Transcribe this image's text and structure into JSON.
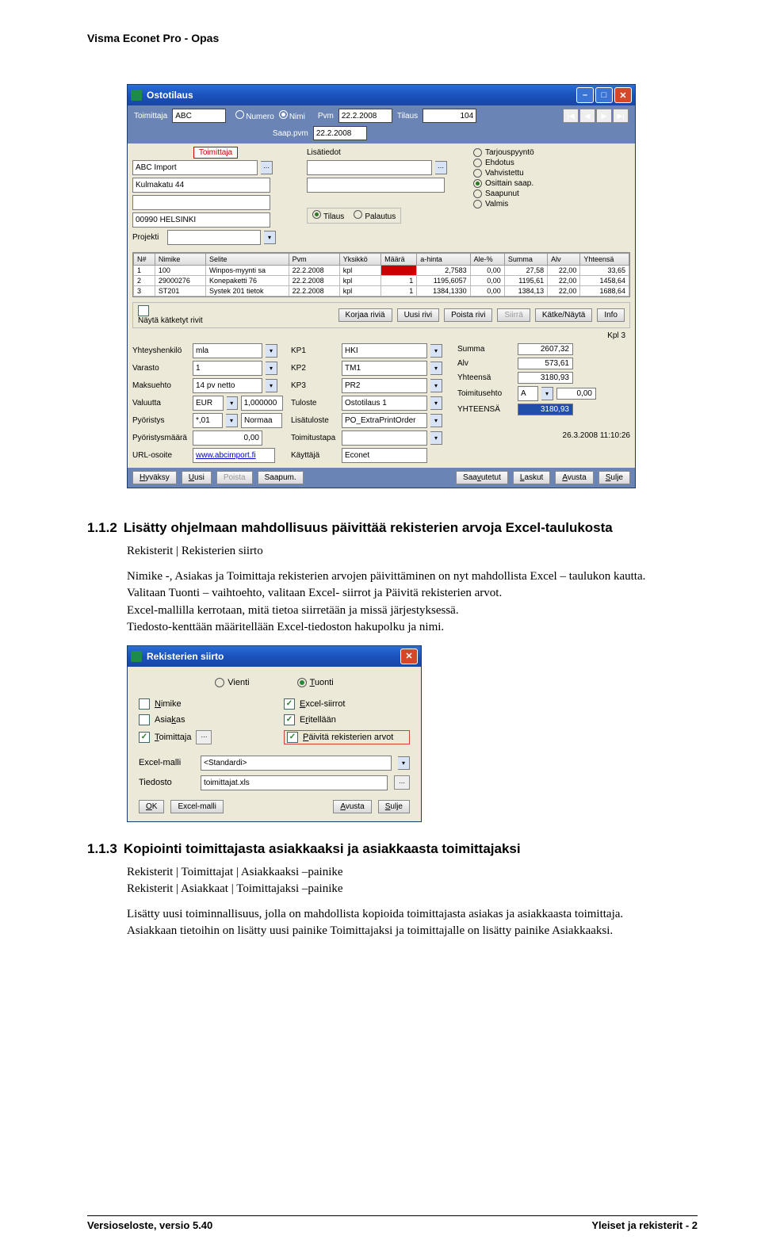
{
  "header": "Visma Econet Pro - Opas",
  "win1": {
    "title": "Ostotilaus",
    "topbar": {
      "toimittaja_label": "Toimittaja",
      "toimittaja_value": "ABC",
      "numero_label": "Numero",
      "nimi_label": "Nimi",
      "pvm_label": "Pvm",
      "pvm_value": "22.2.2008",
      "saap_label": "Saap.pvm",
      "saap_value": "22.2.2008",
      "tilaus_label": "Tilaus",
      "tilaus_value": "104"
    },
    "nav": [
      "|◀",
      "◀",
      "▶",
      "▶|"
    ],
    "tabs": {
      "toimittaja": "Toimittaja",
      "lisatiedot": "Lisätiedot"
    },
    "status": {
      "tarjouspyynto": "Tarjouspyyntö",
      "ehdotus": "Ehdotus",
      "vahvistettu": "Vahvistettu",
      "osittain": "Osittain saap.",
      "saapunut": "Saapunut",
      "valmis": "Valmis"
    },
    "supplier": {
      "name": "ABC Import",
      "addr": "Kulmakatu 44",
      "city": "00990 HELSINKI",
      "projekti_label": "Projekti"
    },
    "tilaus_palautus": {
      "tilaus": "Tilaus",
      "palautus": "Palautus"
    },
    "grid_headers": [
      "N#",
      "Nimike",
      "Selite",
      "Pvm",
      "Yksikkö",
      "Määrä",
      "a-hinta",
      "Ale-%",
      "Summa",
      "Alv",
      "Yhteensä"
    ],
    "grid_rows": [
      {
        "n": "1",
        "nimike": "100",
        "selite": "Winpos-myynti sa",
        "pvm": "22.2.2008",
        "yks": "kpl",
        "maara_red": true,
        "ahinta": "2,7583",
        "ale": "0,00",
        "summa": "27,58",
        "alv": "22,00",
        "yht": "33,65"
      },
      {
        "n": "2",
        "nimike": "29000276",
        "selite": "Konepaketti 76",
        "pvm": "22.2.2008",
        "yks": "kpl",
        "maara": "1",
        "ahinta": "1195,6057",
        "ale": "0,00",
        "summa": "1195,61",
        "alv": "22,00",
        "yht": "1458,64"
      },
      {
        "n": "3",
        "nimike": "ST201",
        "selite": "Systek 201 tietok",
        "pvm": "22.2.2008",
        "yks": "kpl",
        "maara": "1",
        "ahinta": "1384,1330",
        "ale": "0,00",
        "summa": "1384,13",
        "alv": "22,00",
        "yht": "1688,64"
      }
    ],
    "subbar": {
      "nayta": "Näytä kätketyt rivit",
      "korjaa": "Korjaa riviä",
      "uusi": "Uusi rivi",
      "poista": "Poista rivi",
      "siirra": "Siirrä",
      "katke": "Kätke/Näytä",
      "info": "Info",
      "kpl_label": "Kpl",
      "kpl_value": "3"
    },
    "lower_left": {
      "yhteyshenkilo": {
        "k": "Yhteyshenkilö",
        "v": "mla"
      },
      "varasto": {
        "k": "Varasto",
        "v": "1"
      },
      "maksuehto": {
        "k": "Maksuehto",
        "v": "14 pv netto"
      },
      "valuutta": {
        "k": "Valuutta",
        "v": "EUR",
        "rate": "1,000000"
      },
      "pyoristys": {
        "k": "Pyöristys",
        "v": "*,01",
        "v2": "Normaa"
      },
      "pyoristysmaara": {
        "k": "Pyöristysmäärä",
        "v": "0,00"
      },
      "url": {
        "k": "URL-osoite",
        "v": "www.abcimport.fi"
      }
    },
    "lower_mid": {
      "kp1": {
        "k": "KP1",
        "v": "HKI"
      },
      "kp2": {
        "k": "KP2",
        "v": "TM1"
      },
      "kp3": {
        "k": "KP3",
        "v": "PR2"
      },
      "tuloste": {
        "k": "Tuloste",
        "v": "Ostotilaus 1"
      },
      "lisatuloste": {
        "k": "Lisätuloste",
        "v": "PO_ExtraPrintOrder"
      },
      "toimitustapa": {
        "k": "Toimitustapa",
        "v": ""
      },
      "kayttaja": {
        "k": "Käyttäjä",
        "v": "Econet"
      }
    },
    "lower_right": {
      "summa": {
        "k": "Summa",
        "v": "2607,32"
      },
      "alv": {
        "k": "Alv",
        "v": "573,61"
      },
      "yhteensa": {
        "k": "Yhteensä",
        "v": "3180,93"
      },
      "toimitusehto": {
        "k": "Toimitusehto",
        "v": "A",
        "v2": "0,00"
      },
      "totlabel": "YHTEENSÄ",
      "totvalue": "3180,93",
      "ts": "26.3.2008 11:10:26"
    },
    "footbtns": [
      "Hyväksy",
      "Uusi",
      "Poista",
      "Saapum.",
      "Saavutetut",
      "Laskut",
      "Avusta",
      "Sulje"
    ]
  },
  "sec112": {
    "num": "1.1.2",
    "title": "Lisätty ohjelmaan mahdollisuus päivittää rekisterien arvoja Excel-taulukosta",
    "path": "Rekisterit | Rekisterien siirto",
    "p1": "Nimike -, Asiakas ja Toimittaja rekisterien arvojen päivittäminen on nyt mahdollista Excel – taulukon kautta.",
    "p2": "Valitaan Tuonti – vaihtoehto, valitaan Excel- siirrot ja Päivitä rekisterien arvot.",
    "p3": "Excel-mallilla kerrotaan, mitä tietoa siirretään ja missä järjestyksessä.",
    "p4": "Tiedosto-kenttään määritellään Excel-tiedoston hakupolku ja nimi."
  },
  "win2": {
    "title": "Rekisterien siirto",
    "vienti": "Vienti",
    "tuonti": "Tuonti",
    "chk": {
      "nimike": "Nimike",
      "excelsiirrot": "Excel-siirrot",
      "asiakas": "Asiakas",
      "eritellaan": "Eritellään",
      "toimittaja": "Toimittaja",
      "paivita": "Päivitä rekisterien arvot"
    },
    "excelmalli_label": "Excel-malli",
    "excelmalli_value": "<Standardi>",
    "tiedosto_label": "Tiedosto",
    "tiedosto_value": "toimittajat.xls",
    "btns": [
      "OK",
      "Excel-malli",
      "Avusta",
      "Sulje"
    ]
  },
  "sec113": {
    "num": "1.1.3",
    "title": "Kopiointi toimittajasta asiakkaaksi ja asiakkaasta toimittajaksi",
    "path1": "Rekisterit | Toimittajat | Asiakkaaksi –painike",
    "path2": "Rekisterit | Asiakkaat | Toimittajaksi –painike",
    "p1": "Lisätty uusi toiminnallisuus, jolla on mahdollista kopioida toimittajasta asiakas ja asiakkaasta toimittaja.",
    "p2": "Asiakkaan tietoihin on lisätty uusi painike Toimittajaksi ja toimittajalle on lisätty painike Asiakkaaksi."
  },
  "footer": {
    "left": "Versioseloste, versio 5.40",
    "right": "Yleiset ja rekisterit - 2"
  }
}
